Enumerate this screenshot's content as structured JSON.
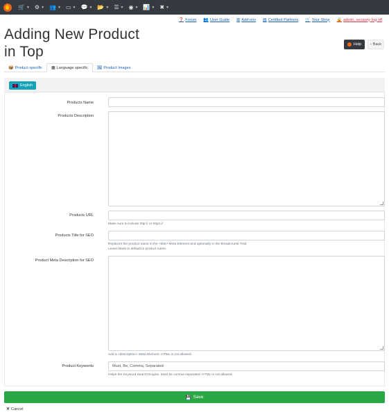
{
  "navbar": {
    "items": [
      {
        "icon": "cart-icon",
        "glyph": "🛒"
      },
      {
        "icon": "cogs-icon",
        "glyph": "⚙"
      },
      {
        "icon": "users-icon",
        "glyph": "👥"
      },
      {
        "icon": "id-card-icon",
        "glyph": "▭"
      },
      {
        "icon": "comments-icon",
        "glyph": "💬"
      },
      {
        "icon": "folder-icon",
        "glyph": "📂"
      },
      {
        "icon": "bars-icon",
        "glyph": "☰"
      },
      {
        "icon": "globe-icon",
        "glyph": "◉"
      },
      {
        "icon": "chart-icon",
        "glyph": "📊"
      },
      {
        "icon": "tools-icon",
        "glyph": "✖"
      }
    ]
  },
  "toplinks": {
    "forum": "Forum",
    "user_guide": "User Guide",
    "addons": "Add-ons",
    "certified_partners": "Certified Partners",
    "your_shop": "Your Shop",
    "logoff": "admin, securely log off"
  },
  "page": {
    "title_line1": "Adding New Product",
    "title_line2": "in Top",
    "help": "Help",
    "back": "Back"
  },
  "tabs": [
    {
      "label": "Product specific",
      "icon": "boxes-icon"
    },
    {
      "label": "Language specific",
      "icon": "language-icon"
    },
    {
      "label": "Product Images",
      "icon": "images-icon"
    }
  ],
  "language": {
    "label": "English"
  },
  "form": {
    "products_name_label": "Products Name",
    "products_description_label": "Products Description",
    "products_url_label": "Products URL",
    "products_url_hint": "Make sure to include http:// or https://",
    "products_title_seo_label": "Products Title for SEO",
    "products_title_seo_hint1": "Replaces the product name in the <title> Meta Element and optionally in the Breadcrumb Trail.",
    "products_title_seo_hint2": "Leave blank to default to product name.",
    "meta_description_label": "Product Meta Description for SEO",
    "meta_description_hint": "Add a <description> Meta Element. HTML is not allowed.",
    "keywords_label": "Product Keywords",
    "keywords_value": "Must, Be, Comma, Separated",
    "keywords_hint": "Helps the Keyword Search Engine. Must be comma separated. HTML is not allowed."
  },
  "actions": {
    "save": "Save",
    "cancel": "Cancel"
  },
  "colors": {
    "navbar": "#343a40",
    "link": "#1a5fb4",
    "danger": "#dc3545",
    "save": "#28a745",
    "lang": "#17a2b8"
  }
}
